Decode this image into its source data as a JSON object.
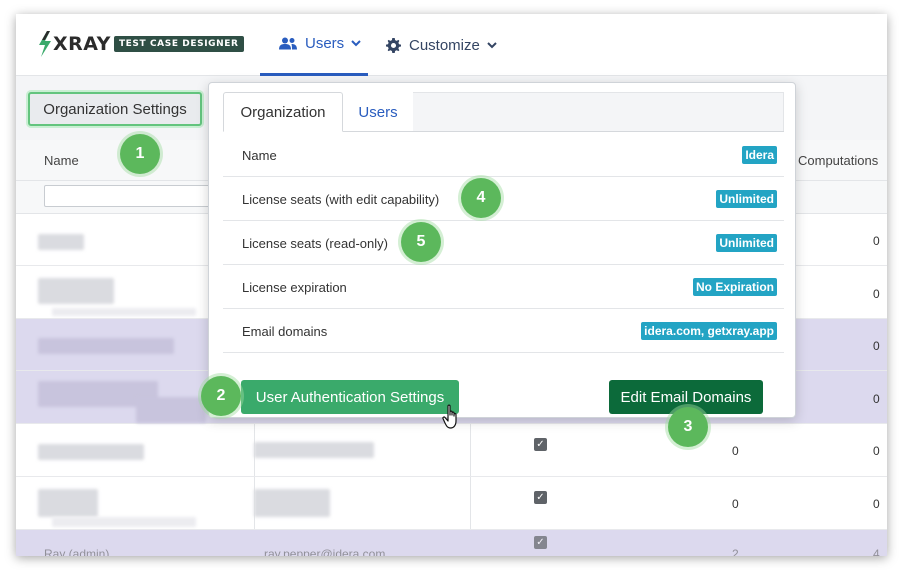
{
  "nav": {
    "logo_word": "XRAY",
    "logo_badge": "TEST CASE DESIGNER",
    "users_label": "Users",
    "customize_label": "Customize"
  },
  "org_settings_button": "Organization Settings",
  "table": {
    "col_name": "Name",
    "col_computations": "Computations",
    "rows": [
      {
        "c1": "",
        "c2": "",
        "comp": "0",
        "highlight": false
      },
      {
        "c1": "",
        "c2": "",
        "comp": "0",
        "highlight": false
      },
      {
        "c1": "",
        "c2": "",
        "comp": "0",
        "highlight": true
      },
      {
        "c1": "",
        "c2": "",
        "comp": "0",
        "highlight": true
      },
      {
        "c1": "",
        "c2": "",
        "num": "0",
        "comp": "0",
        "highlight": false
      },
      {
        "c1": "",
        "c2": "",
        "num": "0",
        "comp": "0",
        "highlight": false
      }
    ],
    "partial_row": {
      "name": "Ray (admin)",
      "email": "ray.pepper@idera.com",
      "num": "2",
      "comp": "4"
    }
  },
  "popover": {
    "tabs": [
      {
        "label": "Organization",
        "active": true
      },
      {
        "label": "Users",
        "active": false
      }
    ],
    "rows": [
      {
        "label": "Name",
        "value": "Idera"
      },
      {
        "label": "License seats (with edit capability)",
        "value": "Unlimited"
      },
      {
        "label": "License seats (read-only)",
        "value": "Unlimited"
      },
      {
        "label": "License expiration",
        "value": "No Expiration"
      },
      {
        "label": "Email domains",
        "value": "idera.com, getxray.app"
      }
    ],
    "auth_button": "User Authentication Settings",
    "email_button": "Edit Email Domains"
  },
  "callouts": [
    "1",
    "2",
    "3",
    "4",
    "5"
  ],
  "colors": {
    "accent_blue": "#2a5dbf",
    "badge_teal": "#23a4c4",
    "green_button": "#3aaa6b",
    "dark_green_button": "#0c6a3a",
    "callout_green": "#5cb85c",
    "row_highlight": "#dcd9ee"
  },
  "icons": [
    "bolt-logo-icon",
    "users-icon",
    "gear-icon",
    "chevron-down-icon",
    "checkbox-checked-icon",
    "hand-pointer-cursor-icon"
  ]
}
